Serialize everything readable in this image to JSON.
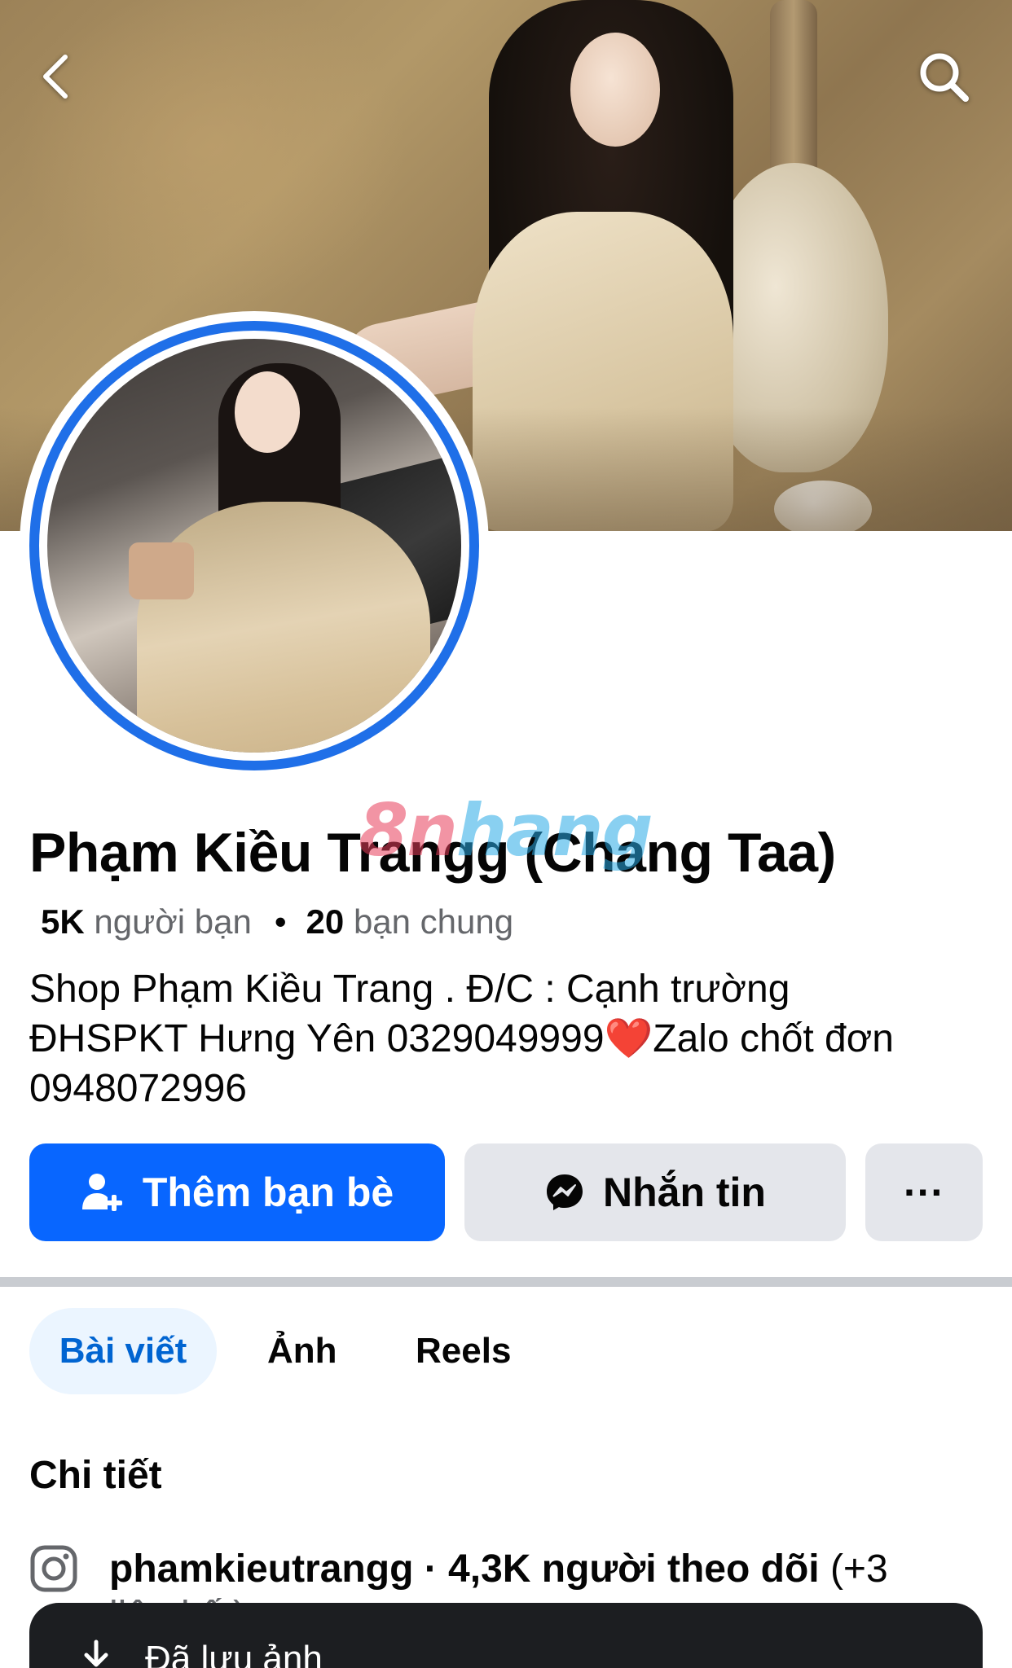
{
  "header": {
    "back_icon": "chevron-left-icon",
    "search_icon": "search-icon"
  },
  "profile": {
    "name": "Phạm Kiều Trangg (Chang Taa)",
    "friends_count": "5K",
    "friends_label": "người bạn",
    "separator": "•",
    "mutual_count": "20",
    "mutual_label": "bạn chung",
    "bio_line1": "Shop Phạm Kiều Trang . Đ/C :  Cạnh trường",
    "bio_line2": "ĐHSPKT Hưng Yên  0329049999❤️Zalo chốt đơn",
    "bio_line3": "0948072996"
  },
  "watermark": {
    "part1": "8n",
    "part2": "hang"
  },
  "actions": {
    "add_friend_label": "Thêm bạn bè",
    "add_friend_icon": "add-friend-icon",
    "message_label": "Nhắn tin",
    "message_icon": "messenger-icon",
    "more_label": "···"
  },
  "tabs": [
    {
      "label": "Bài viết",
      "active": true
    },
    {
      "label": "Ảnh",
      "active": false
    },
    {
      "label": "Reels",
      "active": false
    }
  ],
  "details": {
    "title": "Chi tiết",
    "instagram_icon": "instagram-icon",
    "instagram_handle": "phamkieutrangg",
    "instagram_followers": " · 4,3K người theo dõi",
    "instagram_more": " (+3",
    "cut_line": "liên kết)"
  },
  "toast": {
    "icon": "download-icon",
    "text": "Đã lưu ảnh"
  },
  "colors": {
    "primary": "#0866ff",
    "secondary_button": "#e4e6eb",
    "active_tab_bg": "#ebf5ff",
    "active_tab_text": "#0064d1",
    "avatar_ring": "#1f6fe8",
    "toast_bg": "#1c1e21"
  }
}
